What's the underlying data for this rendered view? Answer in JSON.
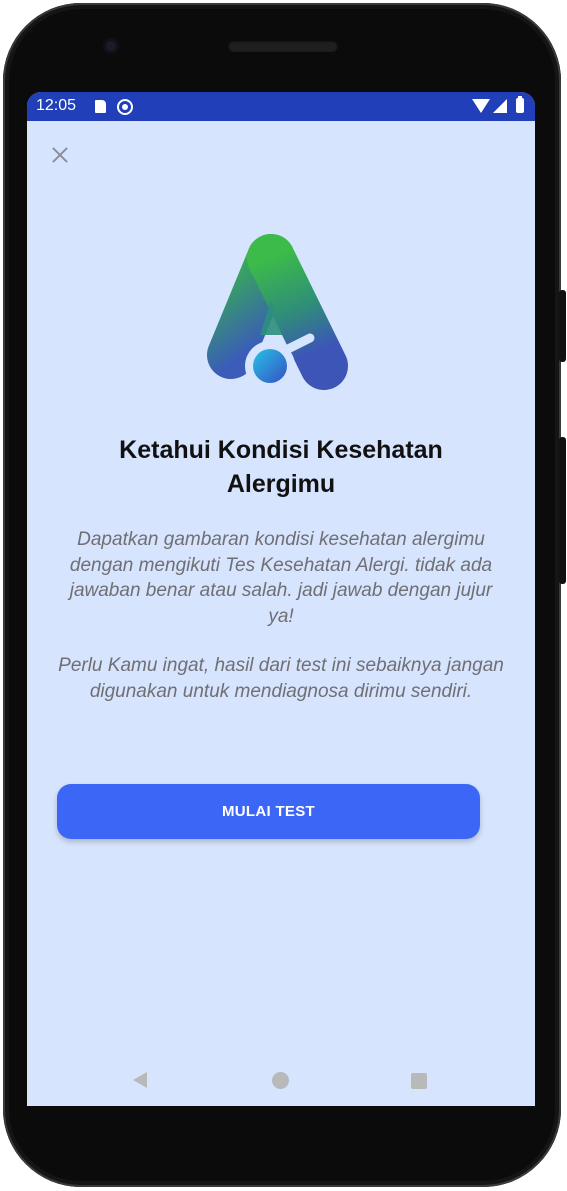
{
  "status_bar": {
    "time": "12:05",
    "icons": [
      "sd-card-icon",
      "sync-icon",
      "wifi-icon",
      "signal-icon",
      "battery-icon"
    ]
  },
  "header": {
    "close_icon": "close-icon"
  },
  "content": {
    "logo_icon": "app-logo-icon",
    "title": "Ketahui Kondisi Kesehatan Alergimu",
    "paragraph_1": "Dapatkan gambaran kondisi kesehatan alergimu dengan mengikuti Tes Kesehatan Alergi. tidak ada jawaban benar atau salah. jadi jawab dengan jujur ya!",
    "paragraph_2": "Perlu Kamu ingat, hasil dari test ini sebaiknya jangan digunakan untuk mendiagnosa dirimu sendiri.",
    "start_button_label": "MULAI TEST"
  },
  "navigation": {
    "back_icon": "back-icon",
    "home_icon": "home-icon",
    "recents_icon": "recents-icon"
  },
  "colors": {
    "status_bar": "#213fb8",
    "screen_background": "#d6e4fe",
    "button": "#3c66f5",
    "logo_green": "#3cba4a",
    "logo_blue": "#3b56b6"
  }
}
